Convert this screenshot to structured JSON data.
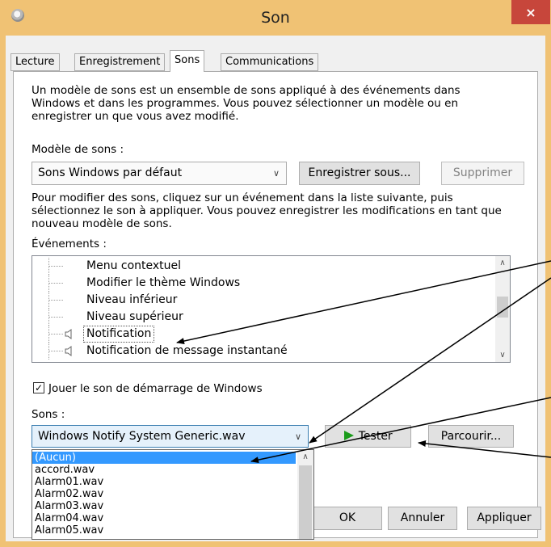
{
  "window": {
    "title": "Son",
    "close_label": "×"
  },
  "tabs": [
    {
      "label": "Lecture"
    },
    {
      "label": "Enregistrement"
    },
    {
      "label": "Sons"
    },
    {
      "label": "Communications"
    }
  ],
  "sounds_tab": {
    "intro_text": "Un modèle de sons est un ensemble de sons appliqué à des événements dans Windows et dans les programmes. Vous pouvez sélectionner un modèle ou en enregistrer un que vous avez modifié.",
    "scheme_label": "Modèle de sons :",
    "scheme_value": "Sons Windows par défaut",
    "save_as_label": "Enregistrer sous...",
    "delete_label": "Supprimer",
    "modify_text": "Pour modifier des sons, cliquez sur un événement dans la liste suivante, puis sélectionnez le son à appliquer. Vous pouvez enregistrer les modifications en tant que nouveau modèle de sons.",
    "events_label": "Événements :",
    "events": [
      {
        "label": "Menu contextuel",
        "has_sound": false
      },
      {
        "label": "Modifier le thème Windows",
        "has_sound": false
      },
      {
        "label": "Niveau inférieur",
        "has_sound": false
      },
      {
        "label": "Niveau supérieur",
        "has_sound": false
      },
      {
        "label": "Notification",
        "has_sound": true,
        "selected": true
      },
      {
        "label": "Notification de message instantané",
        "has_sound": true
      }
    ],
    "startup_sound_label": "Jouer le son de démarrage de Windows",
    "startup_sound_checked": true,
    "sounds_label": "Sons :",
    "sound_value": "Windows Notify System Generic.wav",
    "test_label": "Tester",
    "browse_label": "Parcourir...",
    "sound_options": [
      "(Aucun)",
      "accord.wav",
      "Alarm01.wav",
      "Alarm02.wav",
      "Alarm03.wav",
      "Alarm04.wav",
      "Alarm05.wav"
    ]
  },
  "footer": {
    "ok_label": "OK",
    "cancel_label": "Annuler",
    "apply_label": "Appliquer"
  },
  "colors": {
    "titlebar": "#f0c274",
    "close_button": "#c7463b",
    "selection": "#3399ff",
    "play_icon": "#1a9b1a",
    "annotation_arrow": "#000000"
  }
}
